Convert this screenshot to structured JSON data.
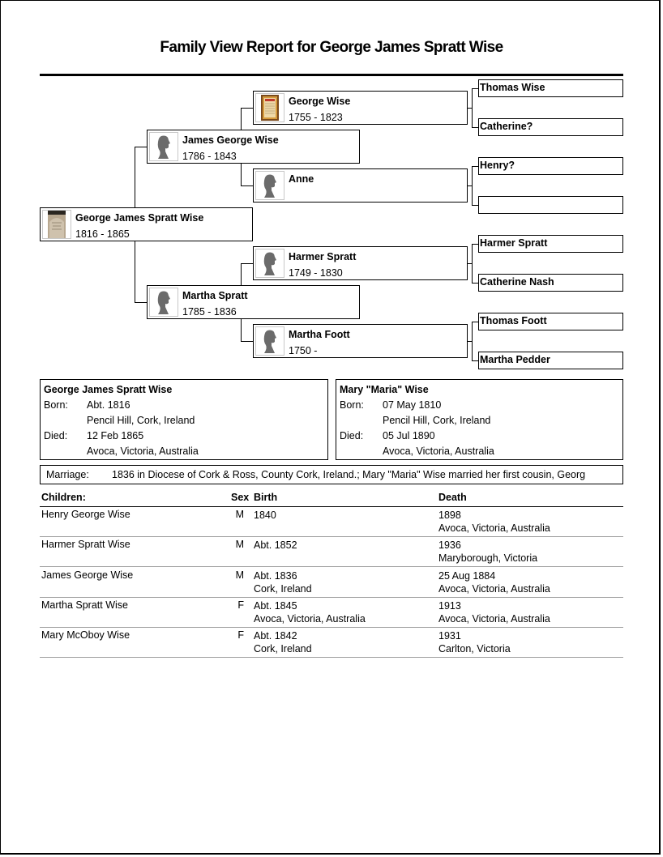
{
  "report": {
    "title": "Family View Report for George James Spratt Wise"
  },
  "pedigree": {
    "root": {
      "name": "George James Spratt Wise",
      "years": "1816 - 1865",
      "photo": "gravestone-photo"
    },
    "father": {
      "name": "James George Wise",
      "years": "1786 - 1843",
      "photo": "silhouette-icon"
    },
    "mother": {
      "name": "Martha Spratt",
      "years": "1785 - 1836",
      "photo": "silhouette-icon"
    },
    "paternal_grandfather": {
      "name": "George Wise",
      "years": "1755 - 1823",
      "photo": "framed-document-photo"
    },
    "paternal_grandmother": {
      "name": "Anne",
      "years": "",
      "photo": "silhouette-icon"
    },
    "maternal_grandfather": {
      "name": "Harmer Spratt",
      "years": "1749 - 1830",
      "photo": "silhouette-icon"
    },
    "maternal_grandmother": {
      "name": "Martha Foott",
      "years": "1750 -",
      "photo": "silhouette-icon"
    },
    "great_grandparents": [
      {
        "name": "Thomas Wise"
      },
      {
        "name": "Catherine?"
      },
      {
        "name": "Henry?"
      },
      {
        "name": ""
      },
      {
        "name": "Harmer Spratt"
      },
      {
        "name": "Catherine Nash"
      },
      {
        "name": "Thomas Foott"
      },
      {
        "name": "Martha Pedder"
      }
    ]
  },
  "husband": {
    "name": "George James Spratt Wise",
    "born_label": "Born:",
    "born_date": "Abt. 1816",
    "born_place": "Pencil Hill, Cork, Ireland",
    "died_label": "Died:",
    "died_date": "12 Feb 1865",
    "died_place": "Avoca, Victoria, Australia"
  },
  "wife": {
    "name": "Mary \"Maria\" Wise",
    "born_label": "Born:",
    "born_date": "07 May 1810",
    "born_place": "Pencil Hill, Cork, Ireland",
    "died_label": "Died:",
    "died_date": "05 Jul 1890",
    "died_place": "Avoca, Victoria, Australia"
  },
  "marriage": {
    "label": "Marriage:",
    "text": "1836 in Diocese of Cork & Ross, County Cork, Ireland.; Mary \"Maria\" Wise married her first cousin, Georg"
  },
  "children": {
    "headers": {
      "name": "Children:",
      "sex": "Sex",
      "birth": "Birth",
      "death": "Death"
    },
    "rows": [
      {
        "name": "Henry George Wise",
        "sex": "M",
        "birth_date": "1840",
        "birth_place": "",
        "death_date": "1898",
        "death_place": "Avoca, Victoria, Australia"
      },
      {
        "name": "Harmer Spratt Wise",
        "sex": "M",
        "birth_date": "Abt. 1852",
        "birth_place": "",
        "death_date": "1936",
        "death_place": "Maryborough, Victoria"
      },
      {
        "name": "James George Wise",
        "sex": "M",
        "birth_date": "Abt. 1836",
        "birth_place": "Cork, Ireland",
        "death_date": "25 Aug 1884",
        "death_place": "Avoca, Victoria, Australia"
      },
      {
        "name": "Martha Spratt Wise",
        "sex": "F",
        "birth_date": "Abt. 1845",
        "birth_place": "Avoca, Victoria, Australia",
        "death_date": "1913",
        "death_place": "Avoca, Victoria, Australia"
      },
      {
        "name": "Mary McOboy Wise",
        "sex": "F",
        "birth_date": "Abt. 1842",
        "birth_place": "Cork, Ireland",
        "death_date": "1931",
        "death_place": "Carlton, Victoria"
      }
    ]
  }
}
